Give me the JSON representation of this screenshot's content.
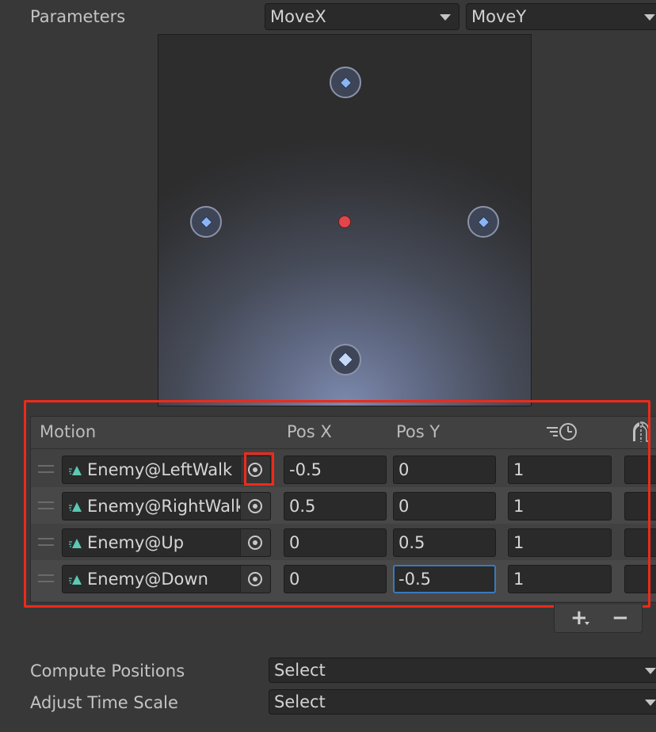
{
  "parameters": {
    "label": "Parameters",
    "param_x": "MoveX",
    "param_y": "MoveY"
  },
  "blend_tree": {
    "node_icon": "diamond-icon",
    "center_color": "#e0464c",
    "node_color": "#8cb4f2"
  },
  "motion_list": {
    "headers": {
      "motion": "Motion",
      "pos_x": "Pos X",
      "pos_y": "Pos Y",
      "time_icon": "time-scale-icon",
      "mirror_icon": "mirror-icon"
    },
    "rows": [
      {
        "name": "Enemy@LeftWalk",
        "pos_x": "-0.5",
        "pos_y": "0",
        "time": "1"
      },
      {
        "name": "Enemy@RightWalk",
        "pos_x": "0.5",
        "pos_y": "0",
        "time": "1"
      },
      {
        "name": "Enemy@Up",
        "pos_x": "0",
        "pos_y": "0.5",
        "time": "1"
      },
      {
        "name": "Enemy@Down",
        "pos_x": "0",
        "pos_y": "-0.5",
        "time": "1"
      }
    ],
    "add_label": "+",
    "remove_label": "−"
  },
  "compute_positions": {
    "label": "Compute Positions",
    "value": "Select"
  },
  "adjust_time_scale": {
    "label": "Adjust Time Scale",
    "value": "Select"
  },
  "colors": {
    "highlight": "#ee2a1a",
    "focus": "#3a79bb",
    "clip_icon": "#5cc8b4"
  }
}
